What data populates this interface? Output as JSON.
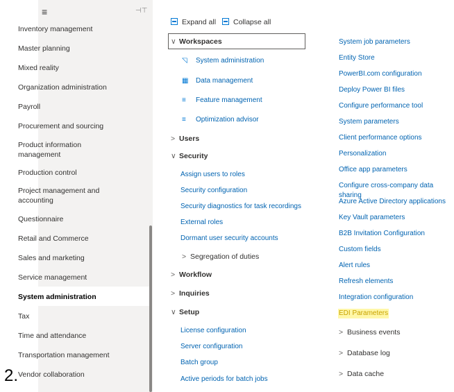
{
  "nav": {
    "items": [
      "Inventory management",
      "Master planning",
      "Mixed reality",
      "Organization administration",
      "Payroll",
      "Procurement and sourcing",
      "Product information management",
      "Production control",
      "Project management and accounting",
      "Questionnaire",
      "Retail and Commerce",
      "Sales and marketing",
      "Service management",
      "System administration",
      "Tax",
      "Time and attendance",
      "Transportation management",
      "Vendor collaboration"
    ]
  },
  "step_label": "2.",
  "toolbar": {
    "expand_all": "Expand all",
    "collapse_all": "Collapse all"
  },
  "groups": {
    "workspaces": {
      "label": "Workspaces",
      "links": [
        "System administration",
        "Data management",
        "Feature management",
        "Optimization advisor"
      ]
    },
    "users": {
      "label": "Users"
    },
    "security": {
      "label": "Security",
      "links": [
        "Assign users to roles",
        "Security configuration",
        "Security diagnostics for task recordings",
        "External roles",
        "Dormant user security accounts"
      ],
      "subgroup": "Segregation of duties"
    },
    "workflow": {
      "label": "Workflow"
    },
    "inquiries": {
      "label": "Inquiries"
    },
    "setup": {
      "label": "Setup",
      "links": [
        "License configuration",
        "Server configuration",
        "Batch group",
        "Active periods for batch jobs"
      ],
      "right_links": [
        "System job parameters",
        "Entity Store",
        "PowerBI.com configuration",
        "Deploy Power BI files",
        "Configure performance tool",
        "System parameters",
        "Client performance options",
        "Personalization",
        "Office app parameters",
        "Configure cross-company data sharing",
        "Azure Active Directory applications",
        "Key Vault parameters",
        "B2B Invitation Configuration",
        "Custom fields",
        "Alert rules",
        "Refresh elements",
        "Integration configuration",
        "EDI Parameters"
      ],
      "right_subgroups": [
        "Business events",
        "Database log",
        "Data cache"
      ]
    }
  }
}
